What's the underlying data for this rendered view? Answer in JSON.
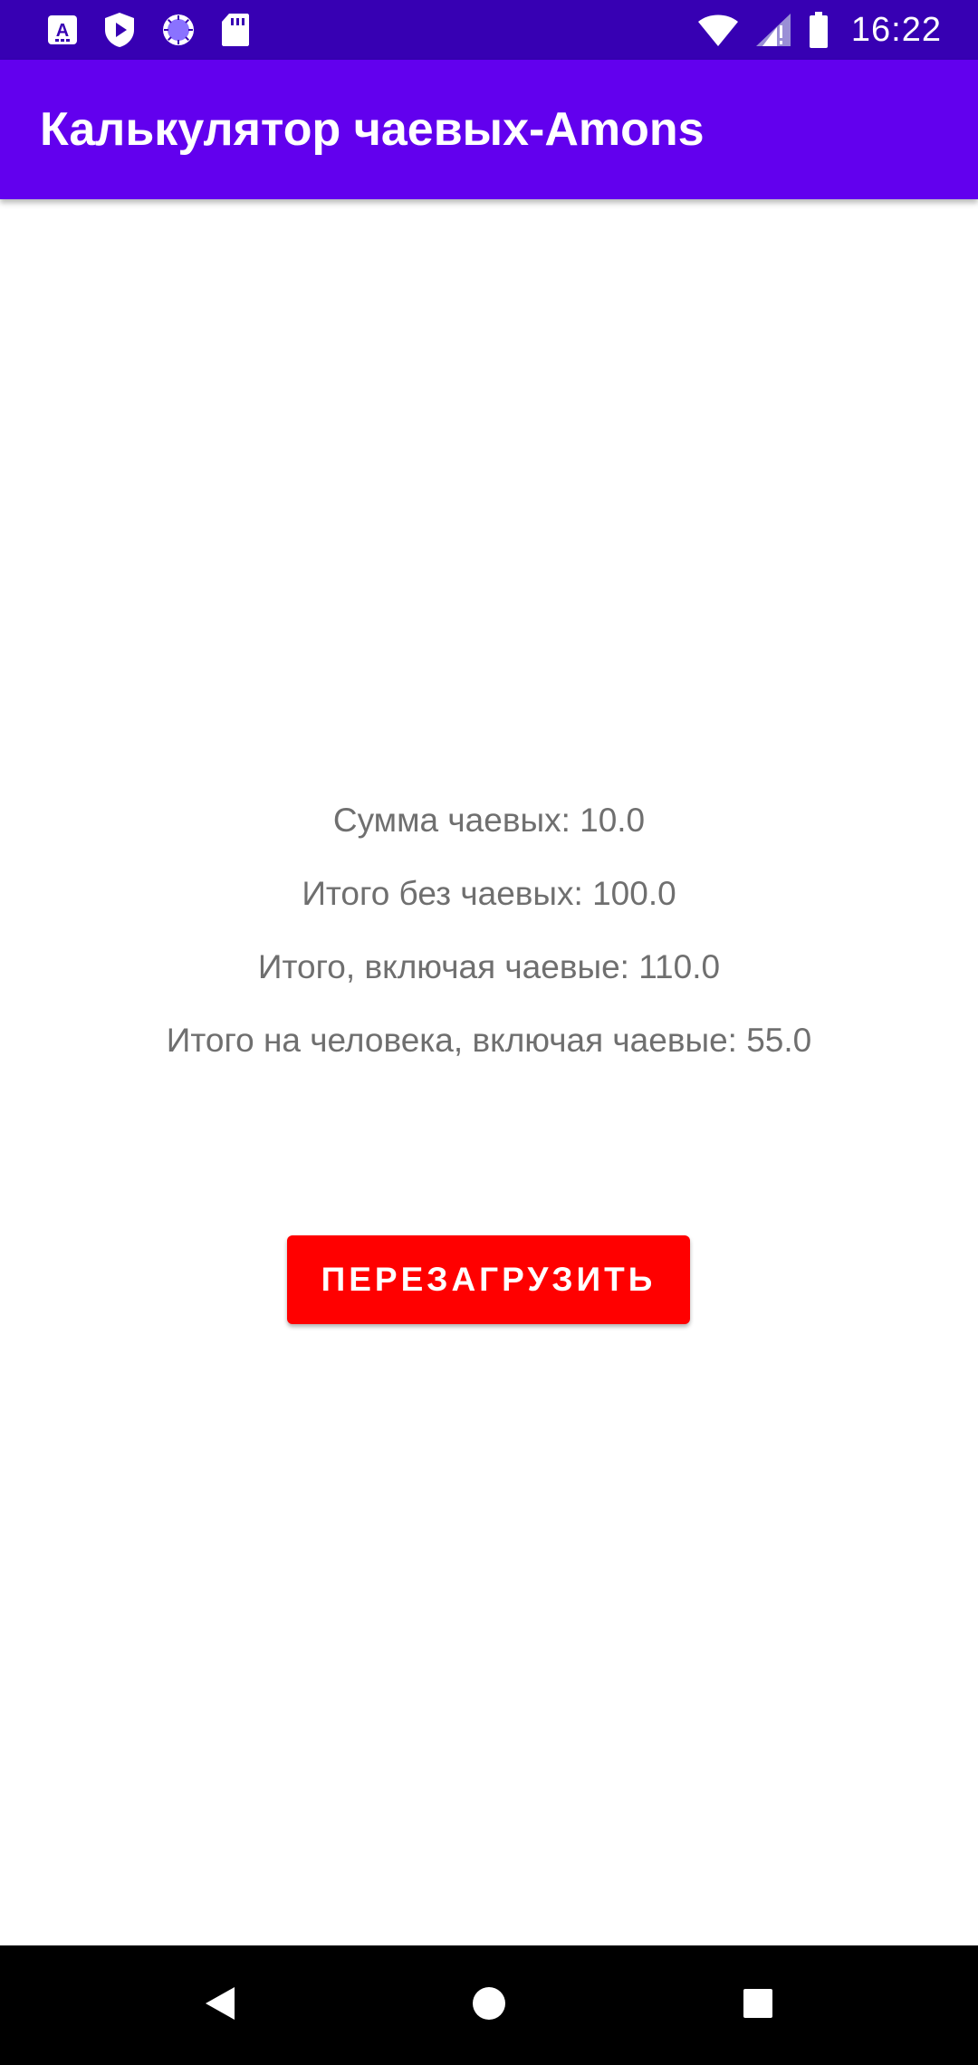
{
  "status_bar": {
    "time": "16:22",
    "left_icons": [
      "translate-icon",
      "shield-play-icon",
      "sync-circle-icon",
      "sd-card-icon"
    ],
    "right_icons": [
      "wifi-icon",
      "signal-icon",
      "battery-icon"
    ]
  },
  "app_bar": {
    "title": "Калькулятор чаевых-Amons",
    "background": "#6200EE"
  },
  "results": {
    "tip_amount": "Сумма чаевых: 10.0",
    "total_without_tip": "Итого без чаевых: 100.0",
    "total_with_tip": "Итого, включая чаевые: 110.0",
    "per_person_with_tip": "Итого на человека, включая чаевые: 55.0"
  },
  "reset_button": {
    "label": "ПЕРЕЗАГРУЗИТЬ",
    "color": "#FF0000"
  },
  "nav_bar": {
    "buttons": [
      "back-icon",
      "home-icon",
      "recents-icon"
    ]
  }
}
